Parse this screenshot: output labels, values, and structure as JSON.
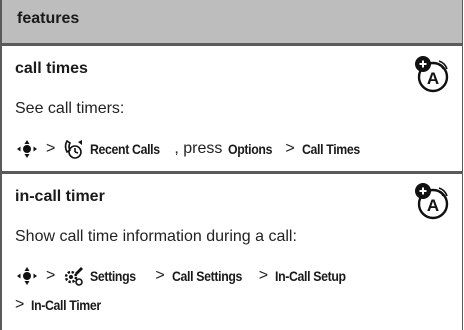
{
  "header": {
    "title": "features"
  },
  "sections": [
    {
      "title": "call times",
      "description": "See call timers:",
      "path": {
        "separator": ">",
        "menu_icon": "recent-calls-icon",
        "item1": "Recent Calls",
        "press_text": ", press",
        "item2": "Options",
        "item3": "Call Times"
      }
    },
    {
      "title": "in-call timer",
      "description": "Show call time information during a call:",
      "path": {
        "separator": ">",
        "menu_icon": "settings-icon",
        "item1": "Settings",
        "item2": "Call Settings",
        "item3": "In-Call Setup",
        "item4": "In-Call Timer"
      }
    }
  ],
  "icons": {
    "nav_key": "nav-key-icon",
    "network": "network-dependent-icon"
  },
  "colors": {
    "header_bg": "#bdbdbd",
    "rule": "#5a5a5a"
  }
}
